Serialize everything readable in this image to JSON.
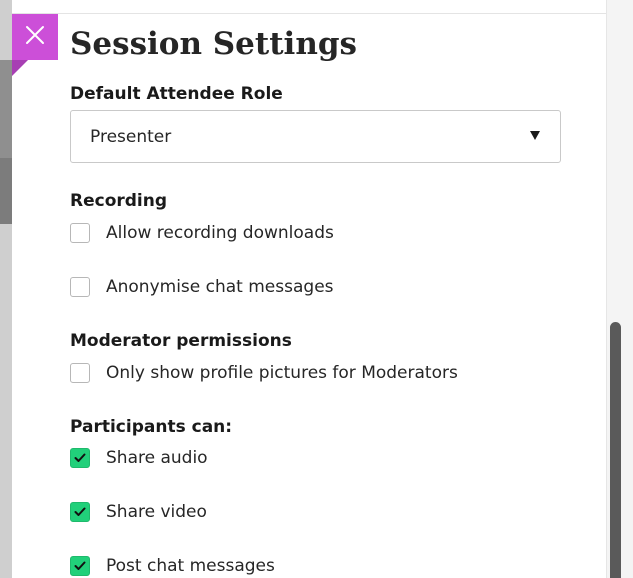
{
  "panel": {
    "title": "Session Settings",
    "close_label": "Close"
  },
  "attendee_role": {
    "label": "Default Attendee Role",
    "selected": "Presenter"
  },
  "recording": {
    "label": "Recording",
    "options": [
      {
        "label": "Allow recording downloads",
        "checked": false
      },
      {
        "label": "Anonymise chat messages",
        "checked": false
      }
    ]
  },
  "moderator": {
    "label": "Moderator permissions",
    "options": [
      {
        "label": "Only show profile pictures for Moderators",
        "checked": false
      }
    ]
  },
  "participants": {
    "label": "Participants can:",
    "options": [
      {
        "label": "Share audio",
        "checked": true
      },
      {
        "label": "Share video",
        "checked": true
      },
      {
        "label": "Post chat messages",
        "checked": true
      }
    ]
  },
  "colors": {
    "close_button": "#cc4fd8",
    "checkbox_checked": "#21d07a"
  },
  "icons": {
    "close": "close-icon",
    "dropdown": "caret-down-icon",
    "check": "checkmark-icon"
  }
}
